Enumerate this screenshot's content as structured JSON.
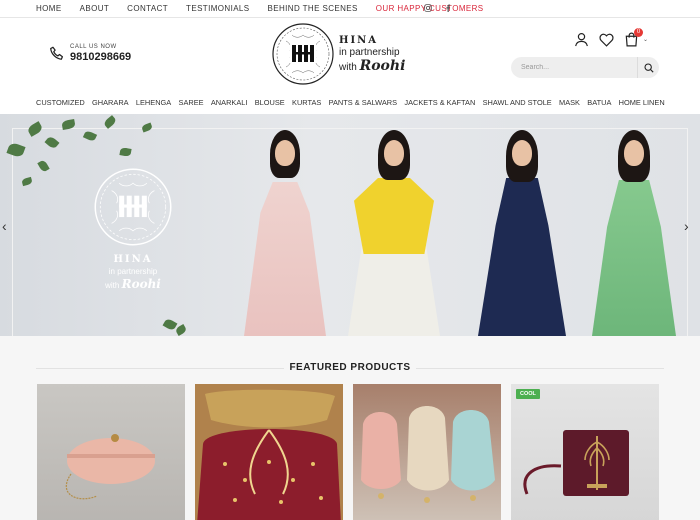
{
  "top_nav": [
    {
      "label": "HOME",
      "highlight": false
    },
    {
      "label": "ABOUT",
      "highlight": false
    },
    {
      "label": "CONTACT",
      "highlight": false
    },
    {
      "label": "TESTIMONIALS",
      "highlight": false
    },
    {
      "label": "BEHIND THE SCENES",
      "highlight": false
    },
    {
      "label": "OUR HAPPY CUSTOMERS",
      "highlight": true
    }
  ],
  "social_icons": [
    "instagram-icon",
    "facebook-icon"
  ],
  "call": {
    "label": "CALL US NOW",
    "number": "9810298669"
  },
  "logo": {
    "word1": "HINA",
    "word2": "in partnership",
    "word3_prefix": "with",
    "word3_script": "Roohi"
  },
  "search": {
    "placeholder": "Search..."
  },
  "cart": {
    "count": "0"
  },
  "categories": [
    "CUSTOMIZED",
    "GHARARA",
    "LEHENGA",
    "SAREE",
    "ANARKALI",
    "BLOUSE",
    "KURTAS",
    "PANTS & SALWARS",
    "JACKETS & KAFTAN",
    "SHAWL AND STOLE",
    "MASK",
    "BATUA",
    "HOME LINEN"
  ],
  "hero": {
    "word1": "HINA",
    "word2": "in partnership",
    "word3_prefix": "with",
    "word3_script": "Roohi"
  },
  "featured": {
    "title": "FEATURED PRODUCTS",
    "products": [
      {
        "badge": ""
      },
      {
        "badge": ""
      },
      {
        "badge": ""
      },
      {
        "badge": "COOL"
      }
    ]
  },
  "colors": {
    "accent_red": "#d9263a",
    "badge_green": "#4caf50",
    "cart_badge": "#e53935"
  }
}
